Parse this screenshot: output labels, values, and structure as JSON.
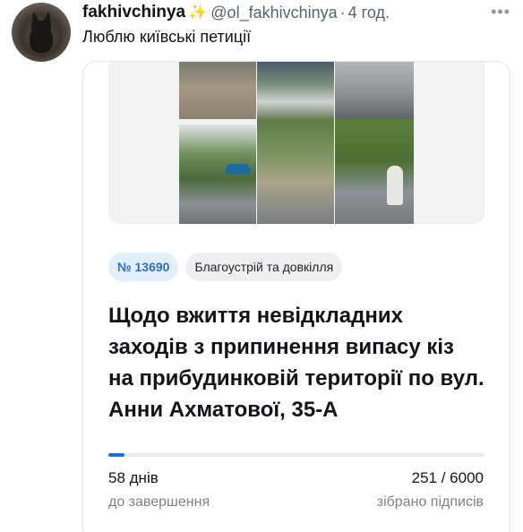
{
  "author": {
    "display_name": "fakhivchinya",
    "emoji": "✨",
    "handle": "@ol_fakhivchinya",
    "separator": "·",
    "time": "4 год."
  },
  "more_menu": "•••",
  "tweet_text": "Люблю київські петиції",
  "card": {
    "petition_number": "№ 13690",
    "category": "Благоустрій та довкілля",
    "title": "Щодо вжиття невідкладних заходів з  припинення випасу кіз на прибудинковій території по вул. Анни Ахматової, 35-А",
    "progress": {
      "collected": 251,
      "goal": 6000
    },
    "days_left_value": "58 днів",
    "days_left_label": "до завершення",
    "signatures_value": "251 / 6000",
    "signatures_label": "зібрано підписів"
  },
  "colors": {
    "accent_blue": "#1f6fd0",
    "badge_blue_bg": "#e3eefb",
    "muted_text": "#536471"
  }
}
